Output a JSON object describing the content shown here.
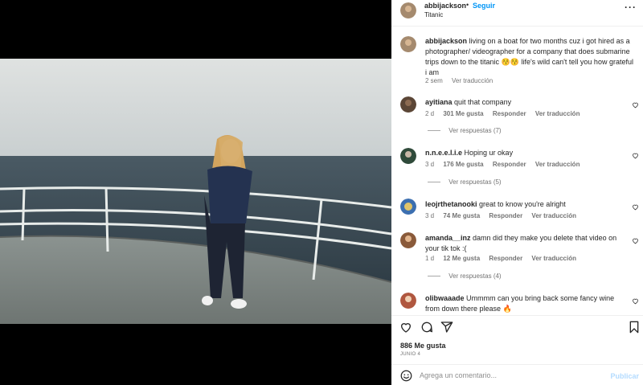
{
  "post": {
    "username": "abbijackson",
    "separator": "•",
    "follow_label": "Seguir",
    "location": "Titanic",
    "more_label": "···"
  },
  "caption": {
    "username": "abbijackson",
    "text": "living on a boat for two months cuz i got hired as a photographer/ videographer for a company that does submarine trips down to the titanic 😚😚 life's wild can't tell you how grateful i am",
    "time": "2 sem",
    "translate": "Ver traducción"
  },
  "comments": [
    {
      "username": "ayitiana",
      "text": "quit that company",
      "time": "2 d",
      "likes": "301 Me gusta",
      "reply": "Responder",
      "translate": "Ver traducción",
      "replies": "Ver respuestas (7)"
    },
    {
      "username": "n.n.e.e.l.i.e",
      "text": "Hoping ur okay",
      "time": "3 d",
      "likes": "176 Me gusta",
      "reply": "Responder",
      "translate": "Ver traducción",
      "replies": "Ver respuestas (5)"
    },
    {
      "username": "leojrthetanooki",
      "text": "great to know you're alright",
      "time": "3 d",
      "likes": "74 Me gusta",
      "reply": "Responder",
      "translate": "Ver traducción",
      "replies": ""
    },
    {
      "username": "amanda__inz",
      "text": "damn did they make you delete that video on your tik tok :(",
      "time": "1 d",
      "likes": "12 Me gusta",
      "reply": "Responder",
      "translate": "Ver traducción",
      "replies": "Ver respuestas (4)"
    },
    {
      "username": "olibwaaade",
      "text": "Ummmm can you bring back some fancy wine from down there please 🔥",
      "time": "",
      "likes": "",
      "reply": "",
      "translate": "",
      "replies": ""
    }
  ],
  "actions": {
    "like_icon": "heart-icon",
    "comment_icon": "comment-icon",
    "share_icon": "share-icon",
    "save_icon": "bookmark-icon"
  },
  "likes": "886 Me gusta",
  "date": "Junio 4",
  "add_comment": {
    "placeholder": "Agrega un comentario...",
    "post_label": "Publicar"
  },
  "colors": {
    "link": "#0095f6",
    "muted": "#737373",
    "post_disabled": "#b3dbff"
  }
}
